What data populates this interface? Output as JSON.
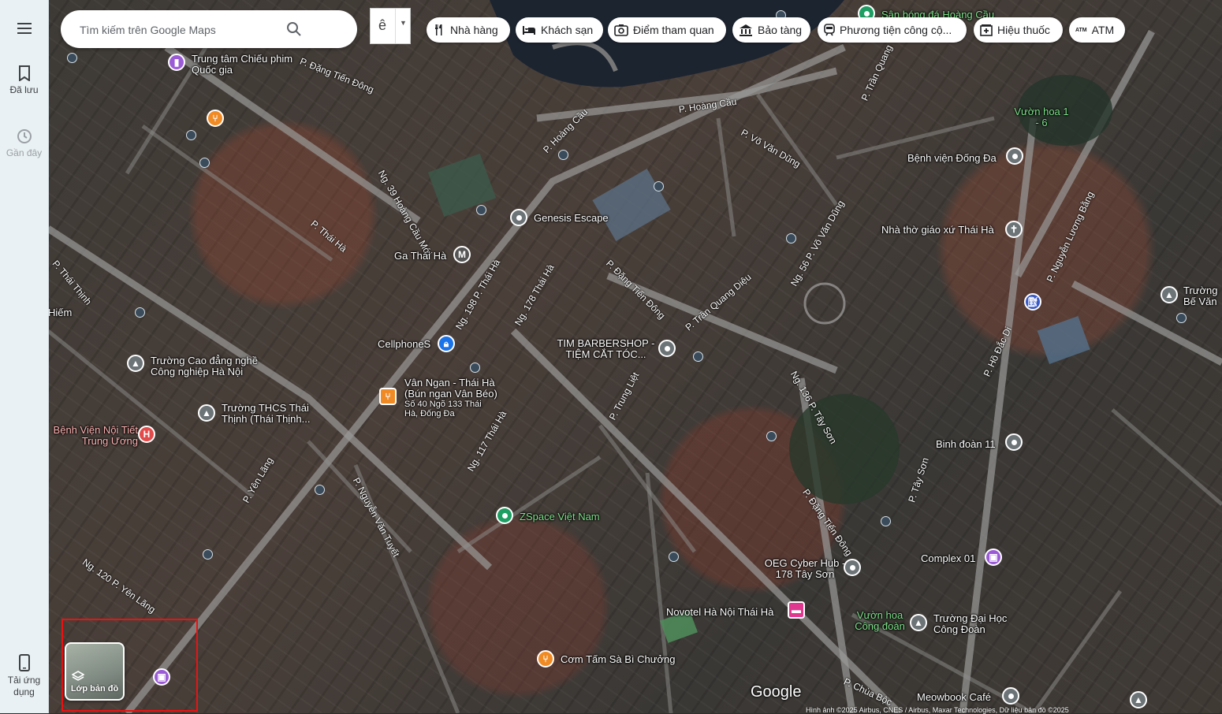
{
  "rail": {
    "saved": "Đã lưu",
    "recent": "Gần đây",
    "get_app": "Tải ứng dụng"
  },
  "search": {
    "placeholder": "Tìm kiếm trên Google Maps"
  },
  "ime": {
    "char": "ê"
  },
  "chips": {
    "restaurants": "Nhà hàng",
    "hotels": "Khách sạn",
    "attractions": "Điểm tham quan",
    "museums": "Bảo tàng",
    "transit": "Phương tiện công cộ...",
    "pharmacies": "Hiệu thuốc",
    "atm": "ATM"
  },
  "places": {
    "cinema": "Trung tâm Chiếu phim Quốc gia",
    "toy_hospital": "Sân bóng đá Hoàng Cầu",
    "genesis": "Genesis Escape",
    "ga_thai_ha": "Ga Thái Hà",
    "cellphones": "CellphoneS",
    "tim_barber": "TIM BARBERSHOP - TIỆM CẮT TÓC...",
    "van_ngan": "Vân Ngan - Thái Hà (Bún ngan Vân Béo)",
    "van_ngan_addr": "Số 40 Ngõ 133 Thái Hà, Đống Đa",
    "college": "Trường Cao đẳng nghề Công nghiệp Hà Nội",
    "thcs": "Trường THCS Thái Thịnh (Thái Thịnh...",
    "hospital": "Bệnh Viện Nội Tiết Trung Ương",
    "zspace": "ZSpace Việt Nam",
    "hien": "Hiếm",
    "dong_da_hospital": "Bệnh viện Đống Đa",
    "church": "Nhà thờ giáo xứ Thái Hà",
    "binh_doan": "Binh đoàn 11",
    "complex": "Complex 01",
    "oeg": "OEG Cyber Hub - 178 Tây Sơn",
    "novotel": "Novotel Hà Nội Thái Hà",
    "vuon_hoa_cd": "Vườn hoa Công đoàn",
    "truong_dai_hoc": "Trường Đại Học Công Đoàn",
    "com_tam": "Cơm Tấm Sà Bì Chưởng",
    "meowbook": "Meowbook Café",
    "vuon_hoa_16": "Vườn hoa 1 - 6",
    "truong_be_van": "Trường Bế Văn"
  },
  "streets": {
    "s1": "P. Đặng Tiến Đông",
    "s2": "P. Hoàng Cầu",
    "s3": "P. Hoàng Cầu",
    "s4": "P. Thái Hà",
    "s5": "P. Thái Thịnh",
    "s6": "P. Yên Lãng",
    "s7": "P. Nguyễn Văn Tuyết",
    "s8": "P. Trung Liệt",
    "s9": "P. Tây Sơn",
    "s10": "P. Hồ Đắc Di",
    "s11": "P. Nguyễn Lương Bằng",
    "s12": "P. Đặng Tiến Đông",
    "s13": "P. Chùa Bộc",
    "s14": "P. Trần Quang Diệu",
    "s15": "P. Võ Văn Dũng",
    "s16": "Ng. 39 Hoàng Cầu Mới",
    "s17": "Ng. 178 Thái Hà",
    "s18": "Ng. 117 Thái Hà",
    "s19": "Ng. 136 P. Tây Sơn",
    "s20": "Ng. 120 P. Yên Lãng",
    "s21": "P. Trần Quang",
    "s22": "Ng. 56 P. Võ Văn Dũng",
    "s23": "P. Đặng Tiến Đông",
    "s24": "Ng. 198 P. Thái Hà"
  },
  "layers": {
    "label": "Lớp bản đồ"
  },
  "footer": {
    "brand": "Google",
    "attribution": "Hình ảnh ©2025 Airbus, CNES / Airbus, Maxar Technologies, Dữ liệu bản đồ ©2025"
  }
}
